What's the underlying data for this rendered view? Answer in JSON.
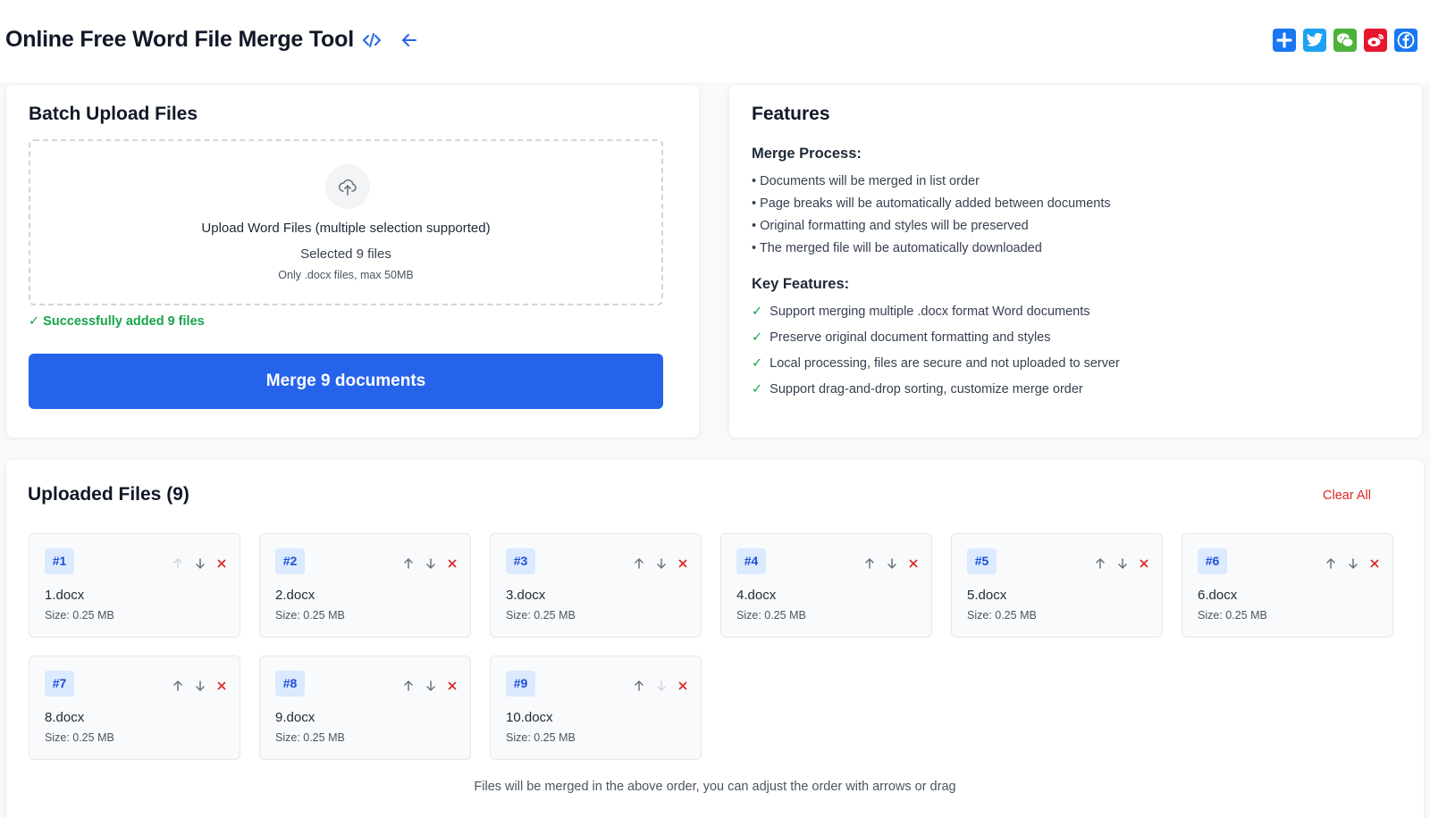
{
  "header": {
    "title": "Online Free Word File Merge Tool",
    "icons": [
      "code-icon",
      "back-arrow-icon"
    ],
    "share": [
      {
        "name": "add-share",
        "color": "#1877f2"
      },
      {
        "name": "twitter",
        "color": "#1da1f2"
      },
      {
        "name": "wechat",
        "color": "#4cb23a"
      },
      {
        "name": "weibo",
        "color": "#e6162d"
      },
      {
        "name": "facebook",
        "color": "#1877f2"
      }
    ]
  },
  "upload": {
    "title": "Batch Upload Files",
    "dropzone_main": "Upload Word Files (multiple selection supported)",
    "selected": "Selected 9 files",
    "hint": "Only .docx files, max 50MB",
    "success": "✓ Successfully added 9 files",
    "merge_label": "Merge 9 documents"
  },
  "features": {
    "title": "Features",
    "process_title": "Merge Process:",
    "process": [
      "• Documents will be merged in list order",
      "• Page breaks will be automatically added between documents",
      "• Original formatting and styles will be preserved",
      "• The merged file will be automatically downloaded"
    ],
    "key_title": "Key Features:",
    "key": [
      "Support merging multiple .docx format Word documents",
      "Preserve original document formatting and styles",
      "Local processing, files are secure and not uploaded to server",
      "Support drag-and-drop sorting, customize merge order"
    ]
  },
  "files": {
    "title": "Uploaded Files (9)",
    "clear_all": "Clear All",
    "items": [
      {
        "num": "#1",
        "name": "1.docx",
        "size": "Size: 0.25 MB"
      },
      {
        "num": "#2",
        "name": "2.docx",
        "size": "Size: 0.25 MB"
      },
      {
        "num": "#3",
        "name": "3.docx",
        "size": "Size: 0.25 MB"
      },
      {
        "num": "#4",
        "name": "4.docx",
        "size": "Size: 0.25 MB"
      },
      {
        "num": "#5",
        "name": "5.docx",
        "size": "Size: 0.25 MB"
      },
      {
        "num": "#6",
        "name": "6.docx",
        "size": "Size: 0.25 MB"
      },
      {
        "num": "#7",
        "name": "8.docx",
        "size": "Size: 0.25 MB"
      },
      {
        "num": "#8",
        "name": "9.docx",
        "size": "Size: 0.25 MB"
      },
      {
        "num": "#9",
        "name": "10.docx",
        "size": "Size: 0.25 MB"
      }
    ],
    "footnote": "Files will be merged in the above order, you can adjust the order with arrows or drag"
  }
}
